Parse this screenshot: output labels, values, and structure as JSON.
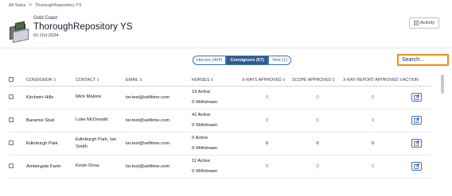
{
  "breadcrumb": {
    "root": "All Sales",
    "separator": ">",
    "current": "ThoroughRepository YS"
  },
  "sale": {
    "location": "Gold Coast",
    "title": "ThoroughRepository YS",
    "date": "01 Oct 2024"
  },
  "header": {
    "activity_label": "Activity",
    "activity_icon": "activity-list-icon"
  },
  "tabs": [
    {
      "label": "Horses (404)",
      "active": false
    },
    {
      "label": "Consignors (57)",
      "active": true
    },
    {
      "label": "Vets (1)",
      "active": false
    }
  ],
  "search": {
    "value": "Search..."
  },
  "table": {
    "columns": {
      "consignor": "CONSIGNOR",
      "contact": "CONTACT",
      "email": "EMAIL",
      "horses": "HORSES",
      "xrays": "X-RAYS APPROVED",
      "scope": "SCOPE APPROVED",
      "xray_report": "X-RAY REPORT APPROVED",
      "action": "ACTION"
    },
    "sort_icon": "sort-arrows-icon",
    "rows": [
      {
        "consignor": "Kitchwin Hills",
        "contact": "Mick Malone",
        "email": "tw-test@selltime.com",
        "active": "15 Active",
        "withdrawn": "0 Withdrawn",
        "xrays": "0",
        "scope": "0",
        "xray_report": "0",
        "zero_color": "#e24b3b"
      },
      {
        "consignor": "Baramul Stud",
        "contact": "Luke McDonald",
        "email": "tw-test@selltime.com",
        "active": "41 Active",
        "withdrawn": "0 Withdrawn",
        "xrays": "0",
        "scope": "0",
        "xray_report": "0",
        "zero_color": "#e24b3b"
      },
      {
        "consignor": "Edinburgh Park",
        "contact": "Edinburgh Park, Ian Smith",
        "email": "tw-test@selltime.com",
        "active": "0 Active",
        "withdrawn": "0 Withdrawn",
        "xrays": "0",
        "scope": "0",
        "xray_report": "0",
        "zero_color": "#111827"
      },
      {
        "consignor": "Ambergate Farm",
        "contact": "Kevin Drew",
        "email": "tw-test@selltime.com",
        "active": "11 Active",
        "withdrawn": "0 Withdrawn",
        "xrays": "0",
        "scope": "0",
        "xray_report": "0",
        "zero_color": "#e24b3b"
      }
    ]
  },
  "colors": {
    "tab_active": "#2e5b8e",
    "search_border": "#f08a1c",
    "zero_red": "#e24b3b",
    "link_blue": "#3b73b9"
  }
}
